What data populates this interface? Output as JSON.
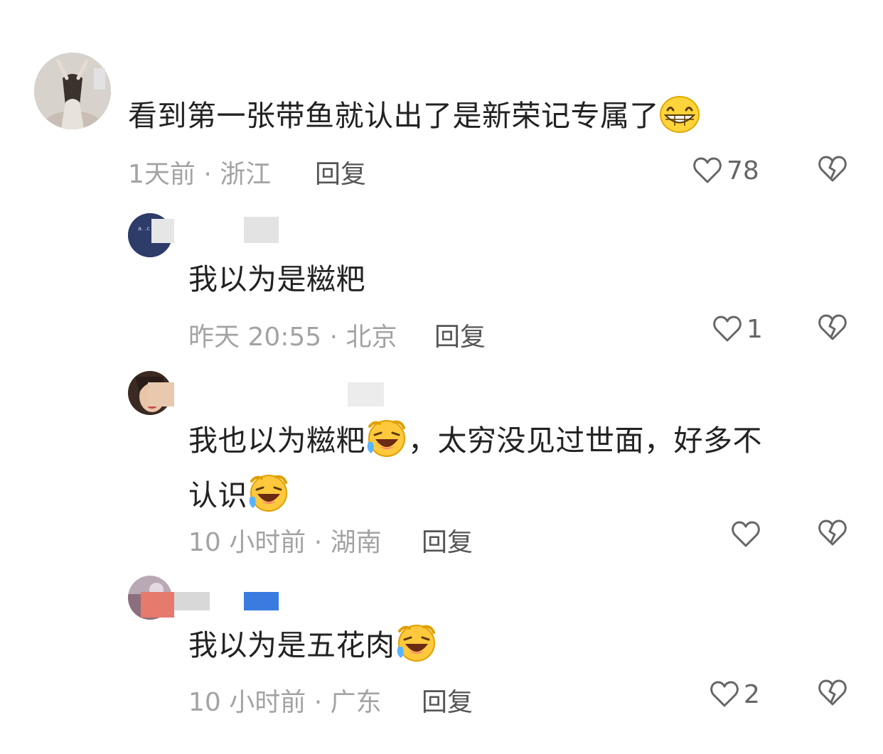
{
  "comments": [
    {
      "text": "看到第一张带鱼就认出了是新荣记专属了",
      "time_location": "1天前 · 浙江",
      "reply": "回复",
      "likes": "78"
    },
    {
      "text": "我以为是糍粑",
      "time_location": "昨天 20:55 · 北京",
      "reply": "回复",
      "likes": "1"
    },
    {
      "text_line1": "我也以为糍粑",
      "text_line1_tail": "，太穷没见过世面，好多不",
      "text_line2": "认识",
      "time_location": "10 小时前 · 湖南",
      "reply": "回复",
      "likes": ""
    },
    {
      "text": "我以为是五花肉",
      "time_location": "10 小时前 · 广东",
      "reply": "回复",
      "likes": "2"
    }
  ],
  "icons": {
    "like": "heart-outline-icon",
    "dislike": "broken-heart-icon",
    "emoji_grin": "grinning-face-emoji",
    "emoji_laugh": "laughing-tears-emoji"
  }
}
